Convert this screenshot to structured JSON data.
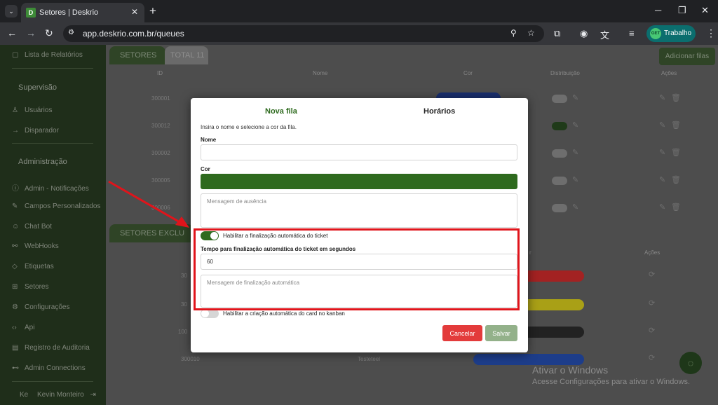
{
  "browser": {
    "tab_title": "Setores | Deskrio",
    "url": "app.deskrio.com.br/queues",
    "profile_name": "Trabalho",
    "profile_avatar_text": "GET"
  },
  "sidebar": {
    "items_top": [
      {
        "label": "Lista de Relatórios",
        "icon": "chat-list-icon"
      }
    ],
    "section_supervisao": "Supervisão",
    "items_supervisao": [
      {
        "label": "Usuários",
        "icon": "users-icon"
      },
      {
        "label": "Disparador",
        "icon": "arrow-right-icon"
      }
    ],
    "section_admin": "Administração",
    "items_admin": [
      {
        "label": "Admin - Notificações",
        "icon": "info-icon"
      },
      {
        "label": "Campos Personalizados",
        "icon": "edit-icon"
      },
      {
        "label": "Chat Bot",
        "icon": "bot-icon"
      },
      {
        "label": "WebHooks",
        "icon": "webhook-icon"
      },
      {
        "label": "Etiquetas",
        "icon": "tag-icon"
      },
      {
        "label": "Setores",
        "icon": "sitemap-icon"
      },
      {
        "label": "Configurações",
        "icon": "gear-icon"
      },
      {
        "label": "Api",
        "icon": "code-icon"
      },
      {
        "label": "Registro de Auditoria",
        "icon": "audit-icon"
      },
      {
        "label": "Admin Connections",
        "icon": "connections-icon"
      }
    ],
    "user_initials": "Ke",
    "user_name": "Kevin Monteiro"
  },
  "main": {
    "tab_setores": "SETORES",
    "tab_total": "TOTAL",
    "total_count": "11",
    "add_button": "Adicionar filas",
    "columns": {
      "id": "ID",
      "name": "Nome",
      "color": "Cor",
      "distribution": "Distribuição",
      "actions": "Ações"
    },
    "rows": [
      {
        "id": "300001",
        "distribution_on": false
      },
      {
        "id": "300012",
        "distribution_on": true
      },
      {
        "id": "300002",
        "distribution_on": false
      },
      {
        "id": "300005",
        "distribution_on": false
      },
      {
        "id": "300006",
        "distribution_on": false
      }
    ],
    "deleted_tab": "SETORES EXCLU",
    "deleted_columns": {
      "color": "r",
      "actions": "Ações"
    },
    "deleted_rows": [
      {
        "id": "30",
        "name": "",
        "color": "#a32222"
      },
      {
        "id": "30",
        "name": "",
        "color": "#a9a016"
      },
      {
        "id": "100",
        "name": "",
        "color": "#222222"
      },
      {
        "id": "300010",
        "name": "Testeteel",
        "color": "#1d3d8a"
      }
    ],
    "colors": {
      "row1": "#1a2f6e"
    }
  },
  "modal": {
    "tab_active": "Nova fila",
    "tab_other": "Horários",
    "hint": "Insira o nome e selecione a cor da fila.",
    "name_label": "Nome",
    "name_value": "",
    "color_label": "Cor",
    "color_value": "#2e6a1e",
    "absence_placeholder": "Mensagem de ausência",
    "auto_close_label": "Habilitar a finalização automática do ticket",
    "auto_close_on": true,
    "timeout_label": "Tempo para finalização automática do ticket em segundos",
    "timeout_value": "60",
    "finish_message_placeholder": "Mensagem de finalização automática",
    "kanban_label": "Habilitar a criação automática do card no kanban",
    "kanban_on": false,
    "cancel": "Cancelar",
    "save": "Salvar"
  },
  "watermark": {
    "title": "Ativar o Windows",
    "subtitle": "Acesse Configurações para ativar o Windows."
  },
  "annotation": {
    "highlight_color": "#e0141b"
  }
}
